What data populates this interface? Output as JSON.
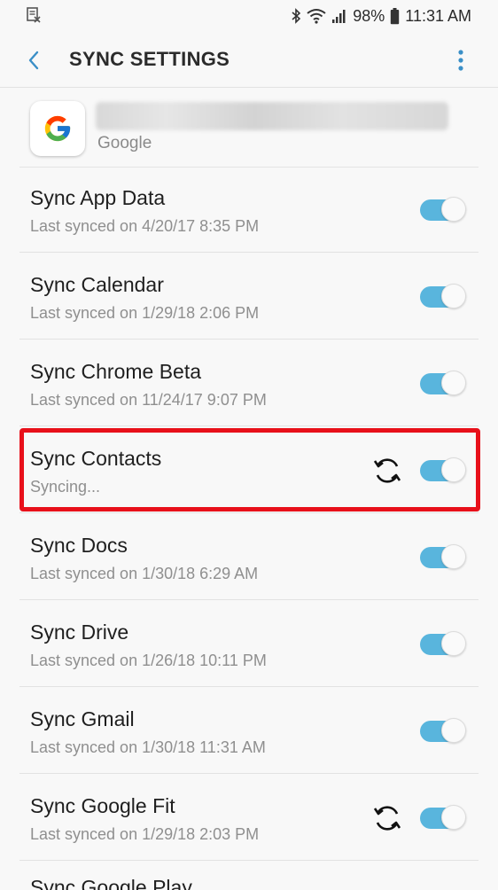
{
  "status_bar": {
    "battery": "98%",
    "time": "11:31 AM"
  },
  "app_bar": {
    "title": "SYNC SETTINGS"
  },
  "account": {
    "type": "Google"
  },
  "sync_items": [
    {
      "title": "Sync App Data",
      "subtitle": "Last synced on 4/20/17  8:35 PM",
      "enabled": true,
      "syncing": false
    },
    {
      "title": "Sync Calendar",
      "subtitle": "Last synced on 1/29/18  2:06 PM",
      "enabled": true,
      "syncing": false
    },
    {
      "title": "Sync Chrome Beta",
      "subtitle": "Last synced on 11/24/17  9:07 PM",
      "enabled": true,
      "syncing": false
    },
    {
      "title": "Sync Contacts",
      "subtitle": "Syncing...",
      "enabled": true,
      "syncing": true
    },
    {
      "title": "Sync Docs",
      "subtitle": "Last synced on 1/30/18  6:29 AM",
      "enabled": true,
      "syncing": false
    },
    {
      "title": "Sync Drive",
      "subtitle": "Last synced on 1/26/18  10:11 PM",
      "enabled": true,
      "syncing": false
    },
    {
      "title": "Sync Gmail",
      "subtitle": "Last synced on 1/30/18  11:31 AM",
      "enabled": true,
      "syncing": false
    },
    {
      "title": "Sync Google Fit",
      "subtitle": "Last synced on 1/29/18  2:03 PM",
      "enabled": true,
      "syncing": true
    }
  ],
  "colors": {
    "toggle_on": "#59b5dd",
    "highlight": "#e8101a",
    "accent": "#3a8fc7"
  }
}
